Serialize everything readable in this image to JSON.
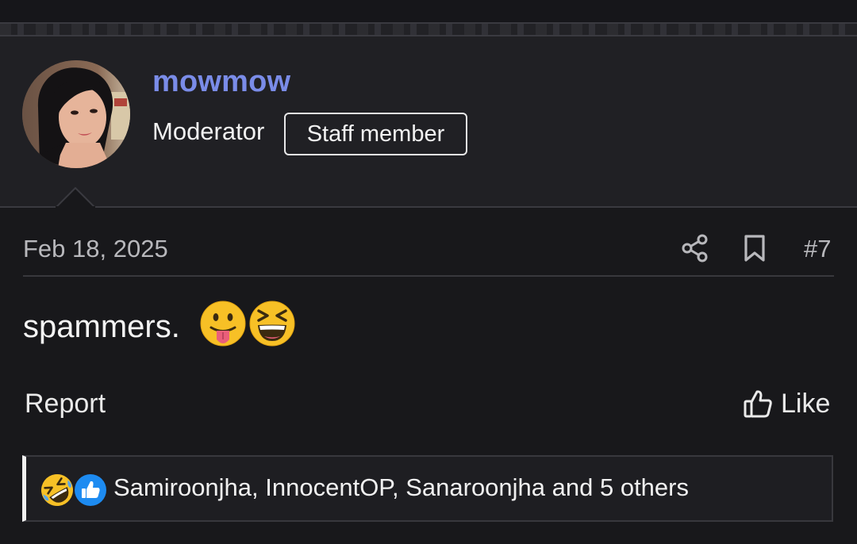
{
  "user": {
    "username": "mowmow",
    "role": "Moderator",
    "badge": "Staff member"
  },
  "post": {
    "date": "Feb 18, 2025",
    "number": "#7",
    "message": "spammers.",
    "message_emojis": [
      "face-with-tongue-emoji",
      "grinning-squinting-face-emoji"
    ]
  },
  "actions": {
    "report_label": "Report",
    "like_label": "Like"
  },
  "reactions": {
    "icons": [
      "rolling-on-floor-laughing-emoji",
      "like-reaction-icon"
    ],
    "summary": "Samiroonjha, InnocentOP, Sanaroonjha and 5 others"
  },
  "colors": {
    "background": "#18181b",
    "header_background": "#202024",
    "username": "#7a8ce8",
    "text": "#ececec",
    "muted_text": "#b8b8bc",
    "like_reaction_blue": "#1d8bf1"
  }
}
